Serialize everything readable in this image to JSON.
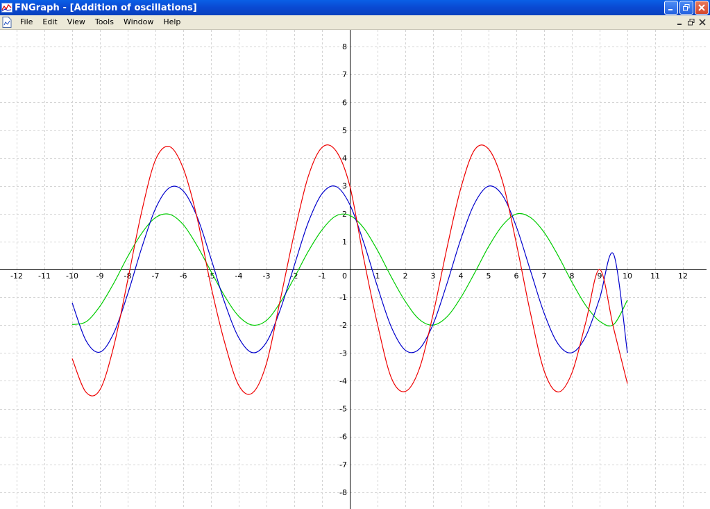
{
  "window": {
    "title": "FNGraph - [Addition of oscillations]"
  },
  "menu": {
    "items": [
      "File",
      "Edit",
      "View",
      "Tools",
      "Window",
      "Help"
    ]
  },
  "chart_data": {
    "type": "line",
    "xlim": [
      -12.6,
      12.85
    ],
    "ylim": [
      -8.6,
      8.6
    ],
    "grid": true,
    "x_ticks": [
      -12,
      -11,
      -10,
      -9,
      -8,
      -7,
      -6,
      -5,
      -4,
      -3,
      -2,
      -1,
      1,
      2,
      3,
      4,
      5,
      6,
      7,
      8,
      9,
      10,
      11,
      12
    ],
    "y_ticks": [
      -8,
      -7,
      -6,
      -5,
      -4,
      -3,
      -2,
      -1,
      1,
      2,
      3,
      4,
      5,
      6,
      7,
      8
    ],
    "origin_label": "0",
    "series": [
      {
        "color": "#00cc00",
        "x": [
          -10,
          -9.5,
          -9,
          -8.5,
          -8,
          -7.5,
          -7,
          -6.5,
          -6,
          -5.5,
          -5,
          -4.5,
          -4,
          -3.5,
          -3,
          -2.5,
          -2,
          -1.5,
          -1,
          -0.5,
          0,
          0.5,
          1,
          1.5,
          2,
          2.5,
          3,
          3.5,
          4,
          4.5,
          5,
          5.5,
          6,
          6.5,
          7,
          7.5,
          8,
          8.5,
          9,
          9.5,
          10
        ],
        "y": [
          -1.98,
          -1.88,
          -1.32,
          -0.49,
          0.46,
          1.29,
          1.86,
          1.98,
          1.61,
          0.85,
          -0.07,
          -0.97,
          -1.68,
          -2.0,
          -1.83,
          -1.18,
          -0.3,
          0.64,
          1.42,
          1.92,
          1.94,
          1.49,
          0.68,
          -0.28,
          -1.15,
          -1.79,
          -2.0,
          -1.7,
          -1.01,
          -0.12,
          0.82,
          1.58,
          1.99,
          1.87,
          1.33,
          0.5,
          -0.45,
          -1.29,
          -1.86,
          -1.98,
          -1.1
        ]
      },
      {
        "color": "#0000cc",
        "x": [
          -10,
          -9.5,
          -9,
          -8.5,
          -8,
          -7.5,
          -7,
          -6.5,
          -6,
          -5.5,
          -5,
          -4.5,
          -4,
          -3.5,
          -3,
          -2.5,
          -2,
          -1.5,
          -1,
          -0.5,
          0,
          0.5,
          1,
          1.5,
          2,
          2.5,
          3,
          3.5,
          4,
          4.5,
          5,
          5.5,
          6,
          6.5,
          7,
          7.5,
          8,
          8.5,
          9,
          9.5,
          10
        ],
        "y": [
          -1.2,
          -2.56,
          -2.97,
          -2.28,
          -0.88,
          0.76,
          2.18,
          2.93,
          2.82,
          1.89,
          0.39,
          -1.21,
          -2.45,
          -2.99,
          -2.61,
          -1.43,
          0.14,
          1.68,
          2.72,
          2.98,
          2.33,
          0.97,
          -0.63,
          -2.08,
          -2.9,
          -2.86,
          -1.97,
          -0.51,
          1.09,
          2.38,
          2.99,
          2.66,
          1.53,
          -0.02,
          -1.57,
          -2.67,
          -2.99,
          -2.4,
          -1.04,
          0.55,
          -3.0
        ]
      },
      {
        "color": "#ee0000",
        "x": [
          -10,
          -9.5,
          -9,
          -8.5,
          -8,
          -7.5,
          -7,
          -6.5,
          -6,
          -5.5,
          -5,
          -4.5,
          -4,
          -3.5,
          -3,
          -2.5,
          -2,
          -1.5,
          -1,
          -0.5,
          0,
          0.5,
          1,
          1.5,
          2,
          2.5,
          3,
          3.5,
          4,
          4.5,
          5,
          5.5,
          6,
          6.5,
          7,
          7.5,
          8,
          8.5,
          9,
          9.5,
          10
        ],
        "y": [
          -3.2,
          -4.41,
          -4.32,
          -2.75,
          -0.39,
          2.06,
          3.93,
          4.41,
          3.63,
          1.85,
          -0.6,
          -2.65,
          -4.16,
          -4.43,
          -3.37,
          -1.07,
          1.29,
          3.33,
          4.38,
          4.26,
          3.0,
          0.4,
          -1.98,
          -3.9,
          -4.38,
          -3.58,
          -1.61,
          0.77,
          2.92,
          4.3,
          4.32,
          3.16,
          0.93,
          -1.53,
          -3.64,
          -4.4,
          -3.72,
          -1.9,
          -0.0,
          -2.1,
          -4.1
        ]
      }
    ]
  }
}
